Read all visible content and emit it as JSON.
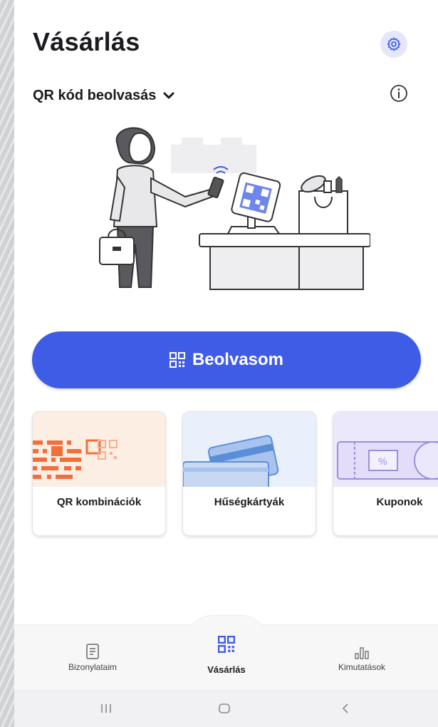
{
  "header": {
    "title": "Vásárlás",
    "settings_icon": "gear-icon"
  },
  "mode_selector": {
    "label": "QR kód beolvasás",
    "chevron_icon": "chevron-down-icon",
    "info_icon": "info-icon"
  },
  "cta": {
    "icon": "qr-code-icon",
    "label": "Beolvasom",
    "color": "#3f5ce6"
  },
  "cards": [
    {
      "label": "QR kombinációk",
      "art_color": "#fdeee3",
      "accent": "#f36f3a"
    },
    {
      "label": "Hűségkártyák",
      "art_color": "#e9effb",
      "accent": "#5a8fd8"
    },
    {
      "label": "Kuponok",
      "art_color": "#ece8fb",
      "accent": "#9b8fdc"
    }
  ],
  "bottom_nav": {
    "items": [
      {
        "label": "Bizonylataim",
        "icon": "receipt-icon",
        "active": false
      },
      {
        "label": "Vásárlás",
        "icon": "qr-code-icon",
        "active": true
      },
      {
        "label": "Kimutatások",
        "icon": "bar-chart-icon",
        "active": false
      }
    ]
  },
  "system_nav": {
    "recents_icon": "recents-icon",
    "home_icon": "home-icon",
    "back_icon": "back-icon"
  }
}
